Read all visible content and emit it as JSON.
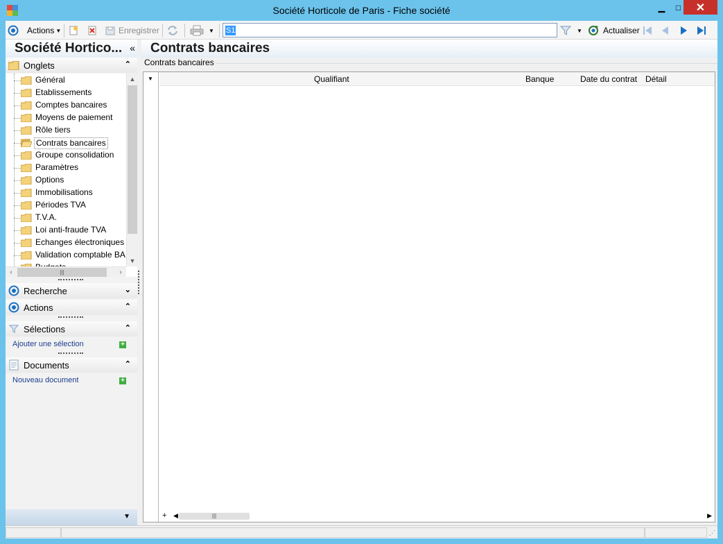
{
  "window": {
    "title": "Société Horticole de Paris -  Fiche société",
    "minimize": "▁",
    "maximize": "□",
    "close": "✕"
  },
  "toolbar": {
    "actions_label": "Actions",
    "save_label": "Enregistrer",
    "search_value": "S1",
    "refresh_label": "Actualiser"
  },
  "left_panel": {
    "title": "Société Hortico...",
    "collapse": "«",
    "sections": {
      "onglets": "Onglets",
      "recherche": "Recherche",
      "actions": "Actions",
      "selections": "Sélections",
      "documents": "Documents"
    },
    "tree_items": [
      {
        "label": "Général"
      },
      {
        "label": "Etablissements"
      },
      {
        "label": "Comptes bancaires"
      },
      {
        "label": "Moyens de paiement"
      },
      {
        "label": "Rôle tiers"
      },
      {
        "label": "Contrats bancaires",
        "selected": true
      },
      {
        "label": "Groupe consolidation"
      },
      {
        "label": "Paramètres"
      },
      {
        "label": "Options"
      },
      {
        "label": "Immobilisations"
      },
      {
        "label": "Périodes TVA"
      },
      {
        "label": "T.V.A."
      },
      {
        "label": "Loi anti-fraude TVA"
      },
      {
        "label": "Echanges électroniques"
      },
      {
        "label": "Validation comptable BA"
      },
      {
        "label": "Budgets"
      }
    ],
    "selections_link": "Ajouter une sélection",
    "documents_link": "Nouveau document"
  },
  "main": {
    "title": "Contrats bancaires",
    "group_label": "Contrats bancaires",
    "columns": [
      "Qualifiant",
      "Banque",
      "Date du contrat",
      "Détail"
    ]
  },
  "colors": {
    "window_frame": "#6bc3ec",
    "close_button": "#c7302a",
    "link": "#1b3d8f",
    "accent_blue": "#1a6fc4",
    "add_green": "#3fae3f"
  }
}
